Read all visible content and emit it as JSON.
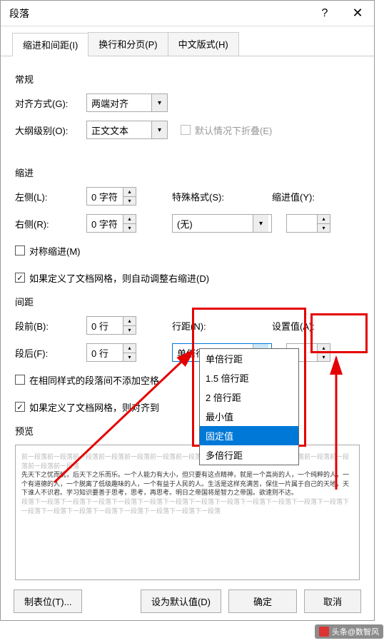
{
  "title": "段落",
  "tabs": {
    "t1": "缩进和间距(I)",
    "t2": "换行和分页(P)",
    "t3": "中文版式(H)"
  },
  "general": {
    "heading": "常规",
    "align_label": "对齐方式(G):",
    "align_value": "两端对齐",
    "outline_label": "大纲级别(O):",
    "outline_value": "正文文本",
    "collapse_label": "默认情况下折叠(E)"
  },
  "indent": {
    "heading": "缩进",
    "left_label": "左侧(L):",
    "left_value": "0 字符",
    "right_label": "右侧(R):",
    "right_value": "0 字符",
    "special_label": "特殊格式(S):",
    "special_value": "(无)",
    "indent_val_label": "缩进值(Y):",
    "mirror_label": "对称缩进(M)",
    "grid_label": "如果定义了文档网格，则自动调整右缩进(D)"
  },
  "spacing": {
    "heading": "间距",
    "before_label": "段前(B):",
    "before_value": "0 行",
    "after_label": "段后(F):",
    "after_value": "0 行",
    "line_label": "行距(N):",
    "line_value": "单倍行距",
    "setval_label": "设置值(A):",
    "nospace_label": "在相同样式的段落间不添加空格",
    "grid_label": "如果定义了文档网格，则对齐到",
    "options": {
      "o1": "单倍行距",
      "o2": "1.5 倍行距",
      "o3": "2 倍行距",
      "o4": "最小值",
      "o5": "固定值",
      "o6": "多倍行距"
    }
  },
  "preview": {
    "heading": "预览",
    "gray_before": "前一段落前一段落前一段落前一段落前一段落前一段落前一段落前一段落前一段落前一段落前一段落前一段落前一段落前一段落前一段落",
    "dark_text": "先天下之忧而忧，后天下之乐而乐。一个人能力有大小，但只要有这点精神，就是一个高尚的人，一个纯粹的人，一个有道德的人，一个脱离了低级趣味的人，一个有益于人民的人。生活是这样充满苦，保住一片属于自己的天地，天下谁人不识君。学习知识要善于思考，思考，再思考。明日之帝国将是智力之帝国。欲速则不达。",
    "gray_after": "段落下一段落下一段落下一段落下一段落下一段落下一段落下一段落下一段落下一段落下一段落下一段落下一段落下一段落下一段落下一段落下一段落下一段落下一段落下一段落下一段落"
  },
  "footer": {
    "tabs_btn": "制表位(T)...",
    "default_btn": "设为默认值(D)",
    "ok": "确定",
    "cancel": "取消"
  },
  "watermark": "头条@数智风"
}
